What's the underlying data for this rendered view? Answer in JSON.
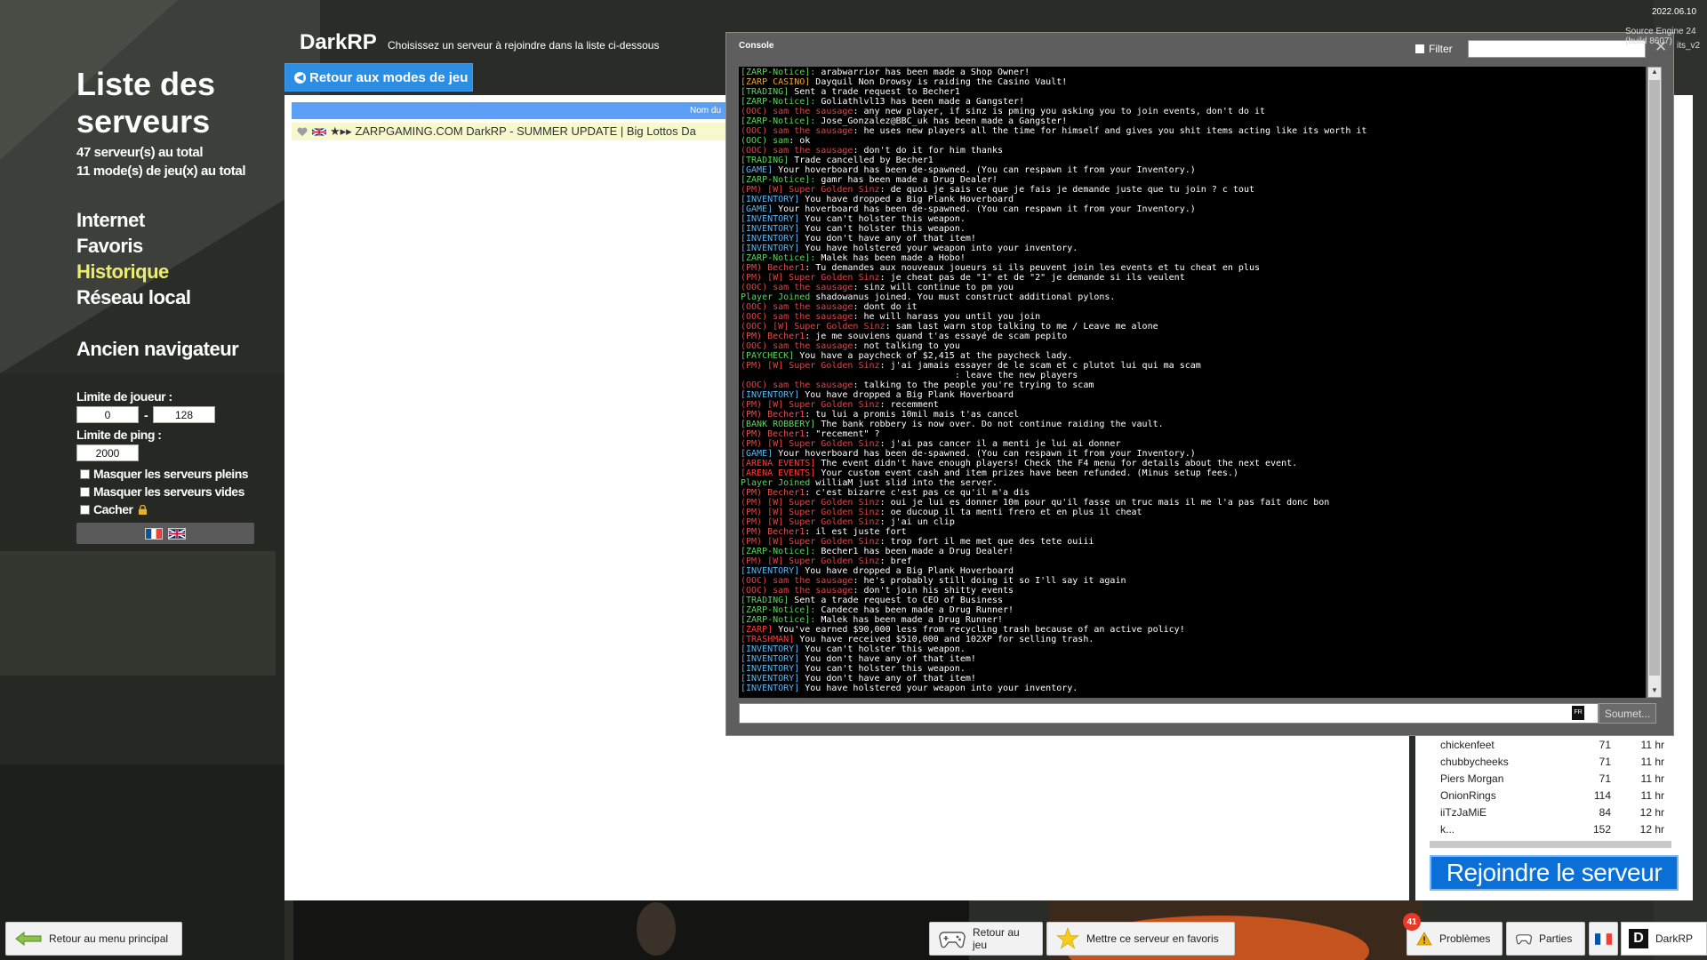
{
  "browser": {
    "title": "Liste des serveurs",
    "server_count": "47 serveur(s) au total",
    "mode_count": "11 mode(s) de jeu(x) au total",
    "nav": [
      "Internet",
      "Favoris",
      "Historique",
      "Réseau local"
    ],
    "old_browser": "Ancien navigateur",
    "player_limit_label": "Limite de joueur :",
    "player_min": "0",
    "player_max": "128",
    "ping_limit_label": "Limite de ping :",
    "ping_max": "2000",
    "hide_full": "Masquer les serveurs pleins",
    "hide_empty": "Masquer les serveurs vides",
    "hide_locked": "Cacher"
  },
  "header": {
    "gamemode": "DarkRP",
    "subtitle": "Choisissez un serveur à rejoindre dans la liste ci-dessous",
    "back_label": "Retour aux modes de jeu"
  },
  "list": {
    "column_name": "Nom du",
    "server_name": "★▸▸ ZARPGAMING.COM DarkRP - SUMMER UPDATE | Big Lottos Da"
  },
  "players": [
    {
      "name": "chickenfeet",
      "score": "71",
      "time": "11 hr"
    },
    {
      "name": "chubbycheeks",
      "score": "71",
      "time": "11 hr"
    },
    {
      "name": "Piers Morgan",
      "score": "71",
      "time": "11 hr"
    },
    {
      "name": "OnionRings",
      "score": "114",
      "time": "11 hr"
    },
    {
      "name": "iiTzJaMiE",
      "score": "84",
      "time": "12 hr"
    },
    {
      "name": "k...",
      "score": "152",
      "time": "12 hr"
    }
  ],
  "join_label": "Rejoindre le serveur",
  "console": {
    "title": "Console",
    "filter_label": "Filter",
    "submit_label": "Soumet...",
    "lang_badge": "FR",
    "lines": [
      [
        [
          "#5fd35f",
          "[ZARP-Notice]: "
        ],
        [
          "#fff",
          "arabwarrior has been made a Shop Owner!"
        ]
      ],
      [
        [
          "#e8a840",
          "[ZARP CASINO] "
        ],
        [
          "#fff",
          "Dayquil Non Drowsy is raiding the Casino Vault!"
        ]
      ],
      [
        [
          "#5fd35f",
          "[TRADING] "
        ],
        [
          "#fff",
          "Sent a trade request to Becher1"
        ]
      ],
      [
        [
          "#5fd35f",
          "[ZARP-Notice]: "
        ],
        [
          "#fff",
          "Goliathlvl13 has been made a Gangster!"
        ]
      ],
      [
        [
          "#d44",
          "(OOC) sam the sausage"
        ],
        [
          "#fff",
          ": any new player, if sinz is pming you asking you to join events, don't do it"
        ]
      ],
      [
        [
          "#5fd35f",
          "[ZARP-Notice]: "
        ],
        [
          "#fff",
          "Jose_Gonzalez@BBC_uk has been made a Gangster!"
        ]
      ],
      [
        [
          "#d44",
          "(OOC) sam the sausage"
        ],
        [
          "#fff",
          ": he uses new players all the time for himself and gives you shit items acting like its worth it"
        ]
      ],
      [
        [
          "#5fd35f",
          "(OOC) sam"
        ],
        [
          "#fff",
          ": ok"
        ]
      ],
      [
        [
          "#d44",
          "(OOC) sam the sausage"
        ],
        [
          "#fff",
          ": don't do it for him thanks"
        ]
      ],
      [
        [
          "#5fd35f",
          "[TRADING] "
        ],
        [
          "#fff",
          "Trade cancelled by Becher1"
        ]
      ],
      [
        [
          "#5fb6f2",
          "[GAME] "
        ],
        [
          "#fff",
          "Your hoverboard has been de-spawned. (You can respawn it from your Inventory.)"
        ]
      ],
      [
        [
          "#5fd35f",
          "[ZARP-Notice]: "
        ],
        [
          "#fff",
          "gamr has been made a Drug Dealer!"
        ]
      ],
      [
        [
          "#d44",
          "(PM) [W] Super Golden Sinz"
        ],
        [
          "#fff",
          ": de quoi je sais ce que je fais je demande juste que tu join ? c tout"
        ]
      ],
      [
        [
          "#5fb6f2",
          "[INVENTORY] "
        ],
        [
          "#fff",
          "You have dropped a Big Plank Hoverboard"
        ]
      ],
      [
        [
          "#5fb6f2",
          "[GAME] "
        ],
        [
          "#fff",
          "Your hoverboard has been de-spawned. (You can respawn it from your Inventory.)"
        ]
      ],
      [
        [
          "#5fb6f2",
          "[INVENTORY] "
        ],
        [
          "#fff",
          "You can't holster this weapon."
        ]
      ],
      [
        [
          "#5fb6f2",
          "[INVENTORY] "
        ],
        [
          "#fff",
          "You can't holster this weapon."
        ]
      ],
      [
        [
          "#5fb6f2",
          "[INVENTORY] "
        ],
        [
          "#fff",
          "You don't have any of that item!"
        ]
      ],
      [
        [
          "#5fb6f2",
          "[INVENTORY] "
        ],
        [
          "#fff",
          "You have holstered your weapon into your inventory."
        ]
      ],
      [
        [
          "#5fd35f",
          "[ZARP-Notice]: "
        ],
        [
          "#fff",
          "Malek has been made a Hobo!"
        ]
      ],
      [
        [
          "#e05050",
          "(PM) Becher1"
        ],
        [
          "#fff",
          ": Tu demandes aux nouveaux joueurs si ils peuvent join les events et tu cheat en plus"
        ]
      ],
      [
        [
          "#d44",
          "(PM) [W] Super Golden Sinz"
        ],
        [
          "#fff",
          ": je cheat pas de \"1\" et de \"2\" je demande si ils veulent"
        ]
      ],
      [
        [
          "#d44",
          "(OOC) sam the sausage"
        ],
        [
          "#fff",
          ": sinz will continue to pm you"
        ]
      ],
      [
        [
          "#5fd35f",
          "Player Joined "
        ],
        [
          "#fff",
          "shadowanus joined. You must construct additional pylons."
        ]
      ],
      [
        [
          "#d44",
          "(OOC) sam the sausage"
        ],
        [
          "#fff",
          ": dont do it"
        ]
      ],
      [
        [
          "#d44",
          "(OOC) sam the sausage"
        ],
        [
          "#fff",
          ": he will harass you until you join"
        ]
      ],
      [
        [
          "#d44",
          "(OOC) [W] Super Golden Sinz"
        ],
        [
          "#fff",
          ": sam last warn stop talking to me / Leave me alone"
        ]
      ],
      [
        [
          "#e05050",
          "(PM) Becher1"
        ],
        [
          "#fff",
          ": je me souviens quand t'as essayé de scam pepito"
        ]
      ],
      [
        [
          "#d44",
          "(OOC) sam the sausage"
        ],
        [
          "#fff",
          ": not talking to you"
        ]
      ],
      [
        [
          "#5fd35f",
          "[PAYCHECK] "
        ],
        [
          "#fff",
          "You have a paycheck of $2,415 at the paycheck lady."
        ]
      ],
      [
        [
          "#d44",
          "(PM) [W] Super Golden Sinz"
        ],
        [
          "#fff",
          ": j'ai jamais essayer de le scam et c plutot lui qui ma scam"
        ]
      ],
      [
        [
          "#fff",
          "                                        : leave the new players"
        ]
      ],
      [
        [
          "#d44",
          "(OOC) sam the sausage"
        ],
        [
          "#fff",
          ": talking to the people you're trying to scam"
        ]
      ],
      [
        [
          "#5fb6f2",
          "[INVENTORY] "
        ],
        [
          "#fff",
          "You have dropped a Big Plank Hoverboard"
        ]
      ],
      [
        [
          "#d44",
          "(PM) [W] Super Golden Sinz"
        ],
        [
          "#fff",
          ": recemment"
        ]
      ],
      [
        [
          "#e05050",
          "(PM) Becher1"
        ],
        [
          "#fff",
          ": tu lui a promis 10mil mais t'as cancel"
        ]
      ],
      [
        [
          "#5fd35f",
          "[BANK ROBBERY] "
        ],
        [
          "#fff",
          "The bank robbery is now over. Do not continue raiding the vault."
        ]
      ],
      [
        [
          "#e05050",
          "(PM) Becher1"
        ],
        [
          "#fff",
          ": \"recement\" ?"
        ]
      ],
      [
        [
          "#d44",
          "(PM) [W] Super Golden Sinz"
        ],
        [
          "#fff",
          ": j'ai pas cancer il a menti je lui ai donner"
        ]
      ],
      [
        [
          "#5fb6f2",
          "[GAME] "
        ],
        [
          "#fff",
          "Your hoverboard has been de-spawned. (You can respawn it from your Inventory.)"
        ]
      ],
      [
        [
          "#ff3b3b",
          "[ARENA EVENTS] "
        ],
        [
          "#fff",
          "The event didn't have enough players! Check the F4 menu for details about the next event."
        ]
      ],
      [
        [
          "#ff3b3b",
          "[ARENA EVENTS] "
        ],
        [
          "#fff",
          "Your custom event cash and item prizes have been refunded. (Minus setup fees.)"
        ]
      ],
      [
        [
          "#5fd35f",
          "Player Joined "
        ],
        [
          "#fff",
          "williaM just slid into the server."
        ]
      ],
      [
        [
          "#e05050",
          "(PM) Becher1"
        ],
        [
          "#fff",
          ": c'est bizarre c'est pas ce qu'il m'a dis"
        ]
      ],
      [
        [
          "#d44",
          "(PM) [W] Super Golden Sinz"
        ],
        [
          "#fff",
          ": oui je lui es donner 10m pour qu'il fasse un truc mais il me l'a pas fait donc bon"
        ]
      ],
      [
        [
          "#d44",
          "(PM) [W] Super Golden Sinz"
        ],
        [
          "#fff",
          ": oe ducoup il ta menti frero et en plus il cheat"
        ]
      ],
      [
        [
          "#d44",
          "(PM) [W] Super Golden Sinz"
        ],
        [
          "#fff",
          ": j'ai un clip"
        ]
      ],
      [
        [
          "#e05050",
          "(PM) Becher1"
        ],
        [
          "#fff",
          ": il est juste fort"
        ]
      ],
      [
        [
          "#d44",
          "(PM) [W] Super Golden Sinz"
        ],
        [
          "#fff",
          ": trop fort il me met que des tete ouiii"
        ]
      ],
      [
        [
          "#5fd35f",
          "[ZARP-Notice]: "
        ],
        [
          "#fff",
          "Becher1 has been made a Drug Dealer!"
        ]
      ],
      [
        [
          "#d44",
          "(PM) [W] Super Golden Sinz"
        ],
        [
          "#fff",
          ": bref"
        ]
      ],
      [
        [
          "#5fb6f2",
          "[INVENTORY] "
        ],
        [
          "#fff",
          "You have dropped a Big Plank Hoverboard"
        ]
      ],
      [
        [
          "#d44",
          "(OOC) sam the sausage"
        ],
        [
          "#fff",
          ": he's probably still doing it so I'll say it again"
        ]
      ],
      [
        [
          "#d44",
          "(OOC) sam the sausage"
        ],
        [
          "#fff",
          ": don't join his shitty events"
        ]
      ],
      [
        [
          "#5fd35f",
          "[TRADING] "
        ],
        [
          "#fff",
          "Sent a trade request to CEO of Business"
        ]
      ],
      [
        [
          "#5fd35f",
          "[ZARP-Notice]: "
        ],
        [
          "#fff",
          "Candece has been made a Drug Runner!"
        ]
      ],
      [
        [
          "#5fd35f",
          "[ZARP-Notice]: "
        ],
        [
          "#fff",
          "Malek has been made a Drug Runner!"
        ]
      ],
      [
        [
          "#ff3b3b",
          "[ZARP] "
        ],
        [
          "#fff",
          "You've earned $90,000 less from recycling trash because of an active policy!"
        ]
      ],
      [
        [
          "#ff3b3b",
          "[TRASHMAN] "
        ],
        [
          "#fff",
          "You have received $510,000 and 102XP for selling trash."
        ]
      ],
      [
        [
          "#5fb6f2",
          "[INVENTORY] "
        ],
        [
          "#fff",
          "You can't holster this weapon."
        ]
      ],
      [
        [
          "#5fb6f2",
          "[INVENTORY] "
        ],
        [
          "#fff",
          "You don't have any of that item!"
        ]
      ],
      [
        [
          "#5fb6f2",
          "[INVENTORY] "
        ],
        [
          "#fff",
          "You can't holster this weapon."
        ]
      ],
      [
        [
          "#5fb6f2",
          "[INVENTORY] "
        ],
        [
          "#fff",
          "You don't have any of that item!"
        ]
      ],
      [
        [
          "#5fb6f2",
          "[INVENTORY] "
        ],
        [
          "#fff",
          "You have holstered your weapon into your inventory."
        ]
      ]
    ]
  },
  "corner": {
    "date": "2022.06.10",
    "build": "Source Engine 24 (build 8607)",
    "build2": "its_v2"
  },
  "bottom": {
    "main_menu": "Retour au menu principal",
    "back_game": "Retour au jeu",
    "favorite": "Mettre ce serveur en favoris",
    "problems": "Problèmes",
    "problems_count": "41",
    "games": "Parties",
    "gamemode_tab": "DarkRP",
    "gamemode_letter": "D"
  },
  "colors": {
    "accent_blue": "#2c8ee2",
    "join_blue": "#0a6fd6",
    "active_nav": "#ecec6e",
    "badge_red": "#e53a28"
  }
}
